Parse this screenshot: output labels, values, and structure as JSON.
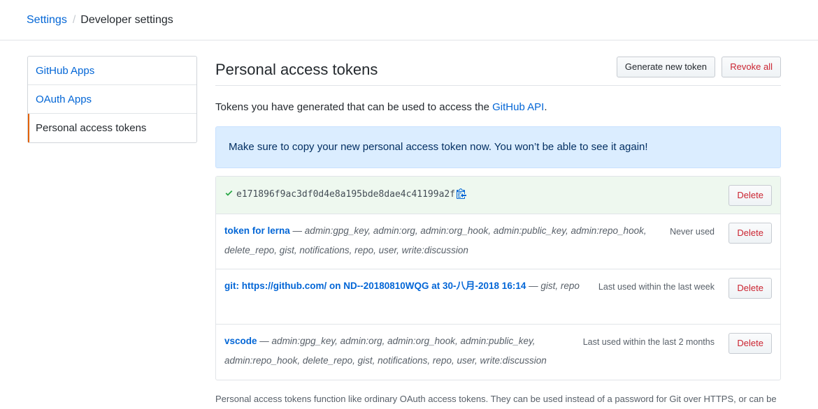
{
  "breadcrumb": {
    "root": "Settings",
    "separator": "/",
    "current": "Developer settings"
  },
  "sidebar": {
    "items": [
      {
        "label": "GitHub Apps"
      },
      {
        "label": "OAuth Apps"
      },
      {
        "label": "Personal access tokens"
      }
    ]
  },
  "main": {
    "title": "Personal access tokens",
    "generate_label": "Generate new token",
    "revoke_label": "Revoke all",
    "intro_prefix": "Tokens you have generated that can be used to access the ",
    "intro_link": "GitHub API",
    "intro_suffix": ".",
    "flash": "Make sure to copy your new personal access token now. You won’t be able to see it again!",
    "new_token": {
      "value": "e171896f9ac3df0d4e8a195bde8dae4c41199a2f",
      "delete_label": "Delete"
    },
    "tokens": [
      {
        "name": "token for lerna",
        "dash": " — ",
        "scopes": "admin:gpg_key, admin:org, admin:org_hook, admin:public_key, admin:repo_hook, delete_repo, gist, notifications, repo, user, write:discussion",
        "last_used": "Never used",
        "delete_label": "Delete"
      },
      {
        "name": "git: https://github.com/ on ND--20180810WQG at 30-八月-2018 16:14",
        "dash": " — ",
        "scopes": "gist, repo",
        "last_used": "Last used within the last week",
        "delete_label": "Delete"
      },
      {
        "name": "vscode",
        "dash": " — ",
        "scopes": "admin:gpg_key, admin:org, admin:org_hook, admin:public_key, admin:repo_hook, delete_repo, gist, notifications, repo, user, write:discussion",
        "last_used": "Last used within the last 2 months",
        "delete_label": "Delete"
      }
    ],
    "footer_note": "Personal access tokens function like ordinary OAuth access tokens. They can be used instead of a password for Git over HTTPS, or can be"
  },
  "colors": {
    "link": "#0366d6",
    "danger": "#cb2431",
    "flash_bg": "#dbedff",
    "success_bg": "#eef8ef",
    "selected_accent": "#e36209"
  },
  "icons": {
    "check": "check-icon",
    "copy": "clippy-icon"
  }
}
